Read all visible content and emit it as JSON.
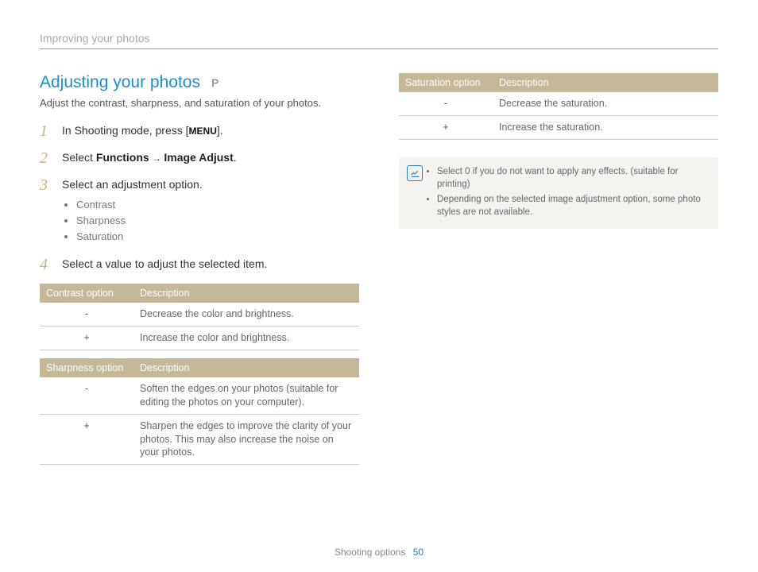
{
  "breadcrumb": "Improving your photos",
  "heading": "Adjusting your photos",
  "mode_badge": "P",
  "subtitle": "Adjust the contrast, sharpness, and saturation of your photos.",
  "steps": [
    {
      "num": "1",
      "pre": "In Shooting mode, press [",
      "chip": "MENU",
      "post": "]."
    },
    {
      "num": "2",
      "text_parts": [
        "Select ",
        "Functions",
        " → ",
        "Image Adjust",
        "."
      ]
    },
    {
      "num": "3",
      "text": "Select an adjustment option.",
      "sub": [
        "Contrast",
        "Sharpness",
        "Saturation"
      ]
    },
    {
      "num": "4",
      "text": "Select a value to adjust the selected item."
    }
  ],
  "tables": {
    "contrast": {
      "headers": [
        "Contrast option",
        "Description"
      ],
      "rows": [
        [
          "-",
          "Decrease the color and brightness."
        ],
        [
          "+",
          "Increase the color and brightness."
        ]
      ]
    },
    "sharpness": {
      "headers": [
        "Sharpness option",
        "Description"
      ],
      "rows": [
        [
          "-",
          "Soften the edges on your photos (suitable for editing the photos on your computer)."
        ],
        [
          "+",
          "Sharpen the edges to improve the clarity of your photos. This may also increase the noise on your photos."
        ]
      ]
    },
    "saturation": {
      "headers": [
        "Saturation option",
        "Description"
      ],
      "rows": [
        [
          "-",
          "Decrease the saturation."
        ],
        [
          "+",
          "Increase the saturation."
        ]
      ]
    }
  },
  "note": {
    "items": [
      {
        "pre": "Select ",
        "bold": "0",
        "post": " if you do not want to apply any effects. (suitable for printing)"
      },
      {
        "text": "Depending on the selected image adjustment option, some photo styles are not available."
      }
    ]
  },
  "footer": {
    "section": "Shooting options",
    "page": "50"
  }
}
